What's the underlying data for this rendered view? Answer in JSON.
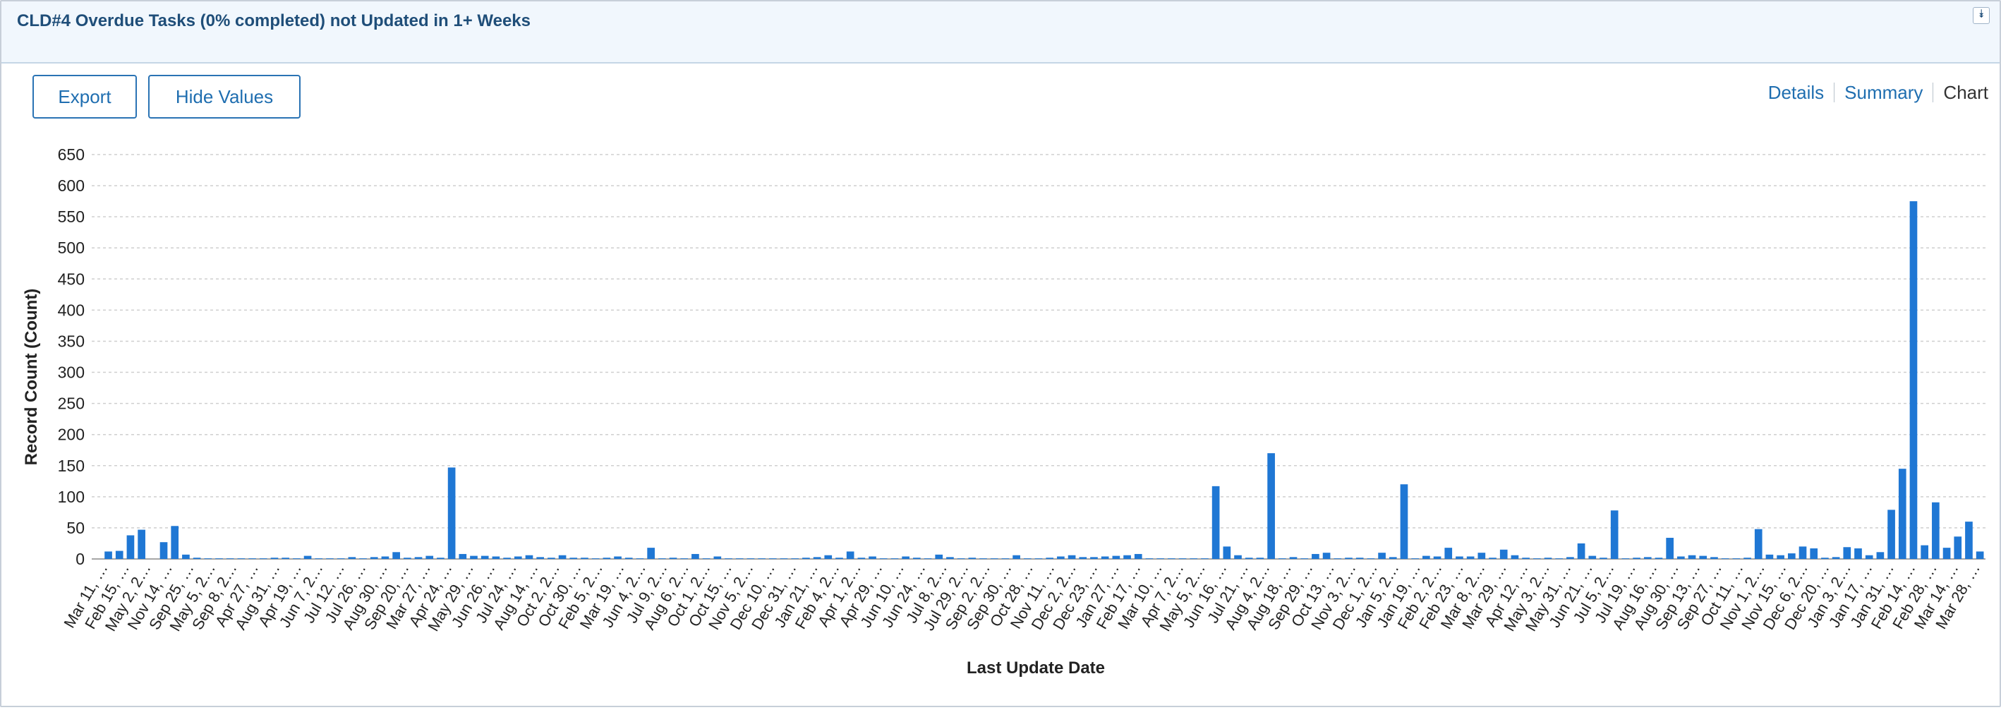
{
  "header": {
    "title": "CLD#4 Overdue Tasks (0% completed) not Updated in 1+ Weeks",
    "collapse_icon": "double-chevron-down-icon"
  },
  "toolbar": {
    "export_label": "Export",
    "hide_values_label": "Hide Values"
  },
  "views": {
    "details": "Details",
    "summary": "Summary",
    "chart": "Chart"
  },
  "chart_data": {
    "type": "bar",
    "xlabel": "Last Update Date",
    "ylabel": "Record Count (Count)",
    "ylim": [
      0,
      650
    ],
    "yticks": [
      0,
      50,
      100,
      150,
      200,
      250,
      300,
      350,
      400,
      450,
      500,
      550,
      600,
      650
    ],
    "grid": true,
    "color": "#1f77d4",
    "tick_labels": [
      "Mar 11, …",
      "Feb 15, …",
      "May 2, 2…",
      "Nov 14, …",
      "Sep 25, …",
      "May 5, 2…",
      "Sep 8, 2…",
      "Apr 27, …",
      "Aug 31, …",
      "Apr 19, …",
      "Jun 7, 2…",
      "Jul 12, …",
      "Jul 26, …",
      "Aug 30, …",
      "Sep 20, …",
      "Mar 27, …",
      "Apr 24, …",
      "May 29, …",
      "Jun 26, …",
      "Jul 24, …",
      "Aug 14, …",
      "Oct 2, 2…",
      "Oct 30, …",
      "Feb 5, 2…",
      "Mar 19, …",
      "Jun 4, 2…",
      "Jul 9, 2…",
      "Aug 6, 2…",
      "Oct 1, 2…",
      "Oct 15, …",
      "Nov 5, 2…",
      "Dec 10, …",
      "Dec 31, …",
      "Jan 21, …",
      "Feb 4, 2…",
      "Apr 1, 2…",
      "Apr 29, …",
      "Jun 10, …",
      "Jun 24, …",
      "Jul 8, 2…",
      "Jul 29, 2…",
      "Sep 2, 2…",
      "Sep 30, …",
      "Oct 28, …",
      "Nov 11, …",
      "Dec 2, 2…",
      "Dec 23, …",
      "Jan 27, …",
      "Feb 17, …",
      "Mar 10, …",
      "Apr 7, 2…",
      "May 5, 2…",
      "Jun 16, …",
      "Jul 21, …",
      "Aug 4, 2…",
      "Aug 18, …",
      "Sep 29, …",
      "Oct 13, …",
      "Nov 3, 2…",
      "Dec 1, 2…",
      "Jan 5, 2…",
      "Jan 19, …",
      "Feb 2, 2…",
      "Feb 23, …",
      "Mar 8, 2…",
      "Mar 29, …",
      "Apr 12, …",
      "May 3, 2…",
      "May 31, …",
      "Jun 21, …",
      "Jul 5, 2…",
      "Jul 19, …",
      "Aug 16, …",
      "Aug 30, …",
      "Sep 13, …",
      "Sep 27, …",
      "Oct 11, …",
      "Nov 1, 2…",
      "Nov 15, …",
      "Dec 6, 2…",
      "Dec 20, …",
      "Jan 3, 2…",
      "Jan 17, …",
      "Jan 31, …",
      "Feb 14, …",
      "Feb 28, …",
      "Mar 14, …",
      "Mar 28, …"
    ],
    "values": [
      0,
      12,
      13,
      38,
      47,
      0,
      27,
      53,
      7,
      2,
      1,
      1,
      1,
      1,
      1,
      1,
      2,
      2,
      1,
      5,
      1,
      1,
      1,
      3,
      1,
      3,
      4,
      11,
      2,
      3,
      5,
      2,
      147,
      8,
      5,
      5,
      4,
      2,
      4,
      6,
      3,
      2,
      6,
      2,
      2,
      1,
      2,
      4,
      2,
      1,
      18,
      1,
      2,
      1,
      8,
      1,
      4,
      1,
      1,
      1,
      1,
      1,
      1,
      1,
      2,
      3,
      6,
      2,
      12,
      2,
      4,
      1,
      1,
      4,
      2,
      1,
      7,
      3,
      1,
      2,
      1,
      1,
      1,
      6,
      1,
      1,
      2,
      4,
      6,
      3,
      3,
      4,
      5,
      6,
      8,
      1,
      1,
      1,
      1,
      1,
      1,
      117,
      20,
      6,
      2,
      2,
      170,
      1,
      3,
      1,
      8,
      10,
      1,
      2,
      2,
      1,
      10,
      3,
      120,
      1,
      5,
      4,
      18,
      4,
      4,
      10,
      2,
      15,
      6,
      2,
      1,
      2,
      1,
      3,
      25,
      5,
      2,
      78,
      1,
      2,
      3,
      2,
      34,
      4,
      6,
      5,
      3,
      1,
      1,
      2,
      48,
      7,
      6,
      9,
      20,
      17,
      2,
      3,
      19,
      17,
      6,
      11,
      79,
      145,
      575,
      22,
      91,
      18,
      36,
      60,
      12
    ]
  }
}
